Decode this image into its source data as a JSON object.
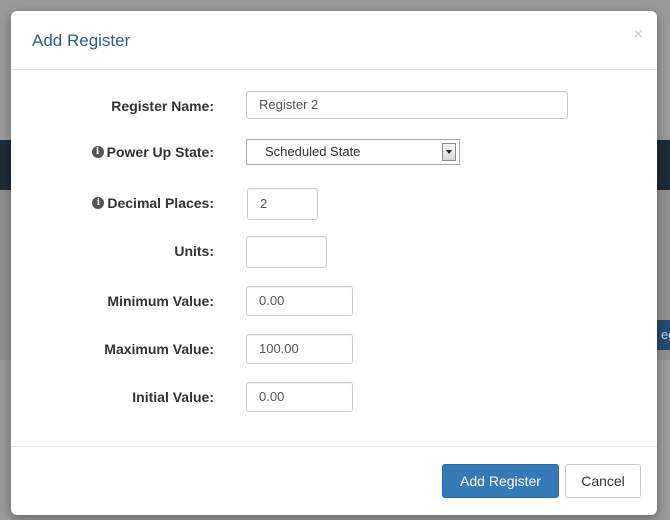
{
  "backdrop": {
    "partial_button_text": "eg"
  },
  "modal": {
    "title": "Add Register",
    "close_symbol": "×"
  },
  "form": {
    "register_name": {
      "label": "Register Name:",
      "value": "Register 2"
    },
    "power_up_state": {
      "label": "Power Up State:",
      "selected": "Scheduled State",
      "icon": "info-icon"
    },
    "decimal_places": {
      "label": "Decimal Places:",
      "value": "2",
      "icon": "info-icon"
    },
    "units": {
      "label": "Units:",
      "value": ""
    },
    "minimum_value": {
      "label": "Minimum Value:",
      "value": "0.00"
    },
    "maximum_value": {
      "label": "Maximum Value:",
      "value": "100.00"
    },
    "initial_value": {
      "label": "Initial Value:",
      "value": "0.00"
    }
  },
  "footer": {
    "primary_label": "Add Register",
    "cancel_label": "Cancel"
  },
  "colors": {
    "title": "#2e5d8f",
    "primary_button": "#337ab7"
  }
}
